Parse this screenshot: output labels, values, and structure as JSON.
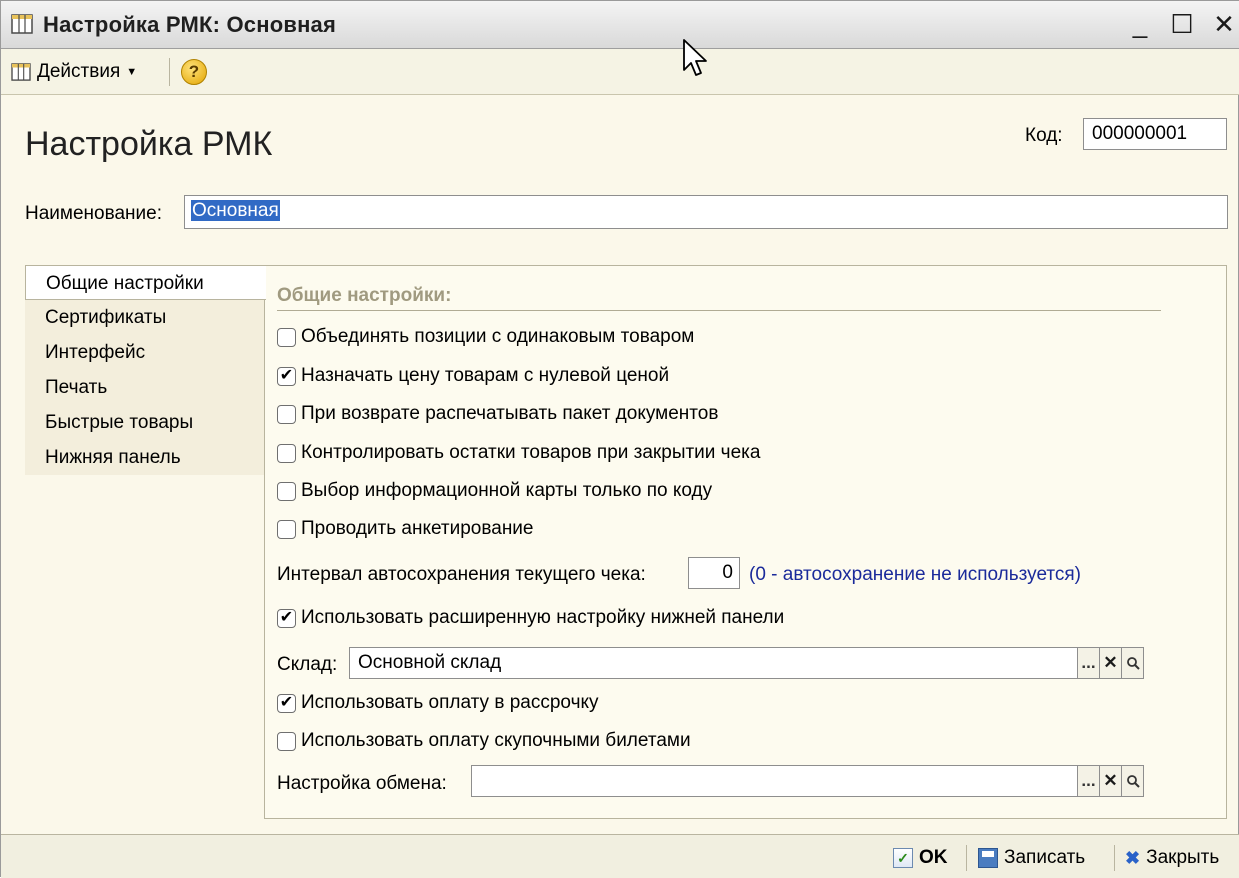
{
  "window": {
    "title": "Настройка РМК: Основная",
    "controls": {
      "minimize": "_",
      "maximize": "☐",
      "close": "✕"
    }
  },
  "toolbar": {
    "actions_label": "Действия",
    "help_label": "?"
  },
  "header": {
    "heading": "Настройка РМК",
    "code_label": "Код:",
    "code_value": "000000001",
    "name_label": "Наименование:",
    "name_value": "Основная"
  },
  "tabs": [
    {
      "label": "Общие настройки",
      "active": true
    },
    {
      "label": "Сертификаты",
      "active": false
    },
    {
      "label": "Интерфейс",
      "active": false
    },
    {
      "label": "Печать",
      "active": false
    },
    {
      "label": "Быстрые товары",
      "active": false
    },
    {
      "label": "Нижняя панель",
      "active": false
    }
  ],
  "general": {
    "section_title": "Общие настройки:",
    "checkboxes": [
      {
        "label": "Объединять позиции с одинаковым товаром",
        "checked": false
      },
      {
        "label": "Назначать цену товарам с нулевой ценой",
        "checked": true
      },
      {
        "label": "При возврате распечатывать пакет документов",
        "checked": false
      },
      {
        "label": "Контролировать остатки товаров при закрытии чека",
        "checked": false
      },
      {
        "label": "Выбор информационной карты только по коду",
        "checked": false
      },
      {
        "label": "Проводить анкетирование",
        "checked": false
      }
    ],
    "interval_label": "Интервал автосохранения текущего чека:",
    "interval_value": "0",
    "interval_hint": "(0 - автосохранение не используется)",
    "extended_panel": {
      "label": "Использовать расширенную настройку нижней панели",
      "checked": true
    },
    "warehouse_label": "Склад:",
    "warehouse_value": "Основной склад",
    "installment": {
      "label": "Использовать оплату в рассрочку",
      "checked": true
    },
    "voucher": {
      "label": "Использовать оплату скупочными билетами",
      "checked": false
    },
    "exchange_label": "Настройка обмена:",
    "exchange_value": "",
    "field_buttons": {
      "select": "...",
      "clear": "✕",
      "open": "🔍"
    }
  },
  "footer": {
    "ok_label": "OK",
    "save_label": "Записать",
    "close_label": "Закрыть"
  },
  "colors": {
    "background": "#fbf8ea",
    "selection": "#316ac5",
    "hint_text": "#1a2a9a",
    "section_title": "#a09a80"
  }
}
